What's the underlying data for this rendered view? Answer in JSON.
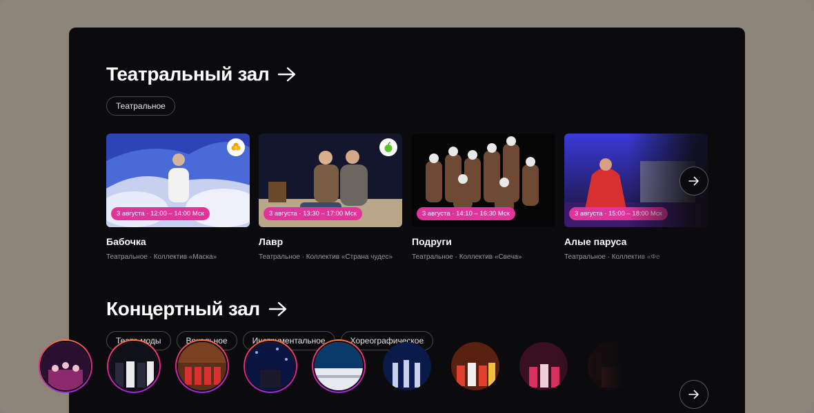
{
  "theater": {
    "title": "Театральный зал",
    "chips": [
      "Театральное"
    ],
    "cards": [
      {
        "title": "Бабочка",
        "time": "3 августа · 12:00 – 14:00 Мск",
        "subtitle": "Театральное · Коллектив «Маска»",
        "badge": "orange-flower-icon"
      },
      {
        "title": "Лавр",
        "time": "3 августа · 13:30 – 17:00 Мск",
        "subtitle": "Театральное · Коллектив «Страна чудес»",
        "badge": "green-apple-icon"
      },
      {
        "title": "Подруги",
        "time": "3 августа · 14:10 – 16:30 Мск",
        "subtitle": "Театральное · Коллектив «Свеча»",
        "badge": ""
      },
      {
        "title": "Алые паруса",
        "time": "3 августа · 15:00 – 18:00 Мск",
        "subtitle": "Театральное · Коллектив «Фе",
        "badge": ""
      }
    ]
  },
  "concert": {
    "title": "Концертный зал",
    "chips": [
      "Театр моды",
      "Вокальное",
      "Инструментальное",
      "Хореографическое"
    ],
    "stories_count": 9
  },
  "colors": {
    "accent_pink": "#e2339a",
    "panel": "#0b0b0d",
    "backdrop": "#8c8379"
  },
  "icons": {
    "section_arrow": "arrow-right-icon",
    "next": "arrow-right-icon"
  }
}
